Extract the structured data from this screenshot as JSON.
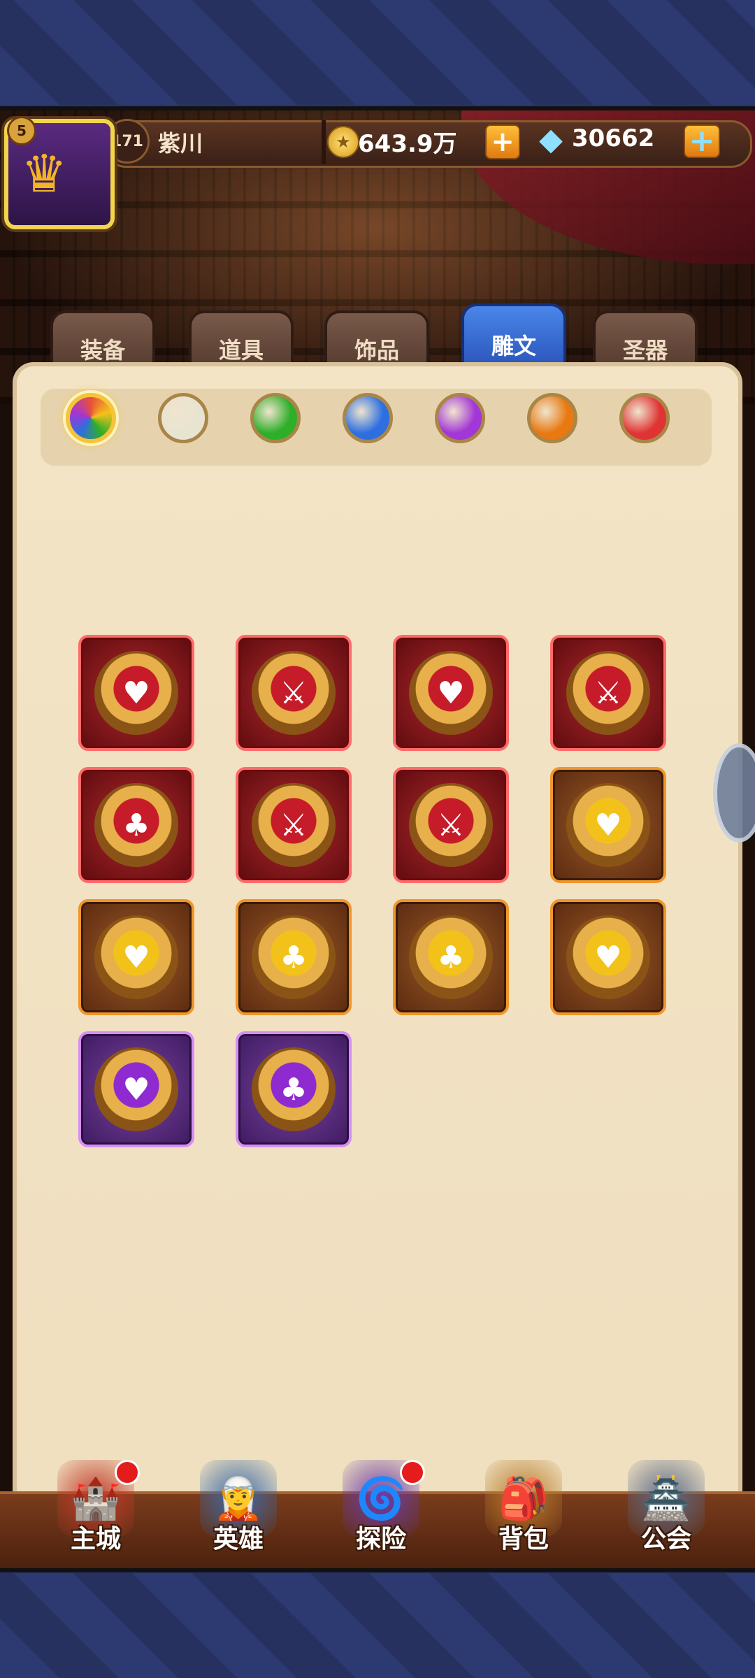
{
  "player": {
    "vip_level": "5",
    "level": "171",
    "name": "紫川"
  },
  "currency": {
    "gold": "643.9万",
    "gems": "30662"
  },
  "tabs": [
    {
      "label": "装备",
      "active": false
    },
    {
      "label": "道具",
      "active": false
    },
    {
      "label": "饰品",
      "active": false
    },
    {
      "label": "雕文",
      "active": true
    },
    {
      "label": "圣器",
      "active": false
    }
  ],
  "color_filters": [
    {
      "name": "all",
      "color": "#e8503a",
      "selected": true
    },
    {
      "name": "white",
      "color": "#e8e4d2",
      "selected": false
    },
    {
      "name": "green",
      "color": "#2fae2a",
      "selected": false
    },
    {
      "name": "blue",
      "color": "#2d6fe0",
      "selected": false
    },
    {
      "name": "purple",
      "color": "#a236d6",
      "selected": false
    },
    {
      "name": "orange",
      "color": "#e87810",
      "selected": false
    },
    {
      "name": "red",
      "color": "#e03434",
      "selected": false
    }
  ],
  "glyphs": [
    {
      "rarity": "red",
      "symbol": "heart"
    },
    {
      "rarity": "red",
      "symbol": "sword"
    },
    {
      "rarity": "red",
      "symbol": "heart"
    },
    {
      "rarity": "red",
      "symbol": "sword"
    },
    {
      "rarity": "red",
      "symbol": "trefoil"
    },
    {
      "rarity": "red",
      "symbol": "sword"
    },
    {
      "rarity": "red",
      "symbol": "sword"
    },
    {
      "rarity": "orange",
      "symbol": "heart"
    },
    {
      "rarity": "orange",
      "symbol": "heart"
    },
    {
      "rarity": "orange",
      "symbol": "trefoil"
    },
    {
      "rarity": "orange",
      "symbol": "trefoil"
    },
    {
      "rarity": "orange",
      "symbol": "heart"
    },
    {
      "rarity": "purple",
      "symbol": "heart"
    },
    {
      "rarity": "purple",
      "symbol": "trefoil"
    }
  ],
  "nav": [
    {
      "label": "主城",
      "icon": "castle-icon",
      "badge": true
    },
    {
      "label": "英雄",
      "icon": "hero-icon",
      "badge": false
    },
    {
      "label": "探险",
      "icon": "portal-icon",
      "badge": true
    },
    {
      "label": "背包",
      "icon": "backpack-icon",
      "badge": false
    },
    {
      "label": "公会",
      "icon": "guild-tower-icon",
      "badge": false
    }
  ]
}
